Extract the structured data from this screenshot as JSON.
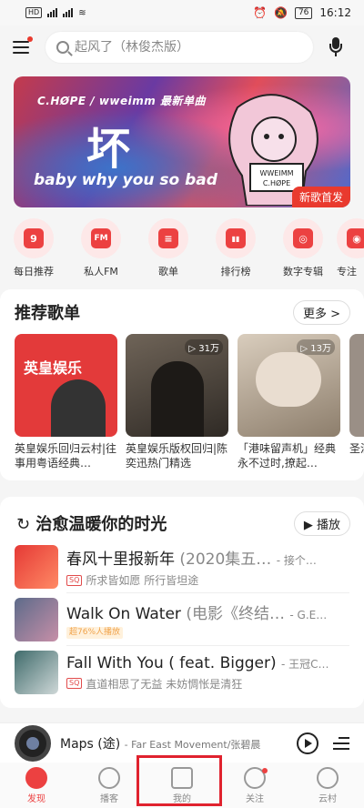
{
  "status_bar": {
    "left": "HD 2 5G 4G",
    "battery": "76",
    "time": "16:12"
  },
  "search": {
    "placeholder": "起风了（林俊杰版）"
  },
  "banner": {
    "top_text": "C.HØPE / wweimm  最新单曲",
    "big_text": "坏",
    "subtitle": "baby why you so bad",
    "badge": "新歌首发",
    "album_text": "WWEIMM C.HØPE"
  },
  "quick_entries": [
    {
      "label": "每日推荐",
      "glyph": "9",
      "icon": "calendar-icon"
    },
    {
      "label": "私人FM",
      "glyph": "FM",
      "icon": "radio-icon"
    },
    {
      "label": "歌单",
      "glyph": "≡",
      "icon": "playlist-icon"
    },
    {
      "label": "排行榜",
      "glyph": "▮▮",
      "icon": "chart-icon"
    },
    {
      "label": "数字专辑",
      "glyph": "◎",
      "icon": "album-icon"
    },
    {
      "label": "专注",
      "glyph": "◉",
      "icon": "focus-icon"
    }
  ],
  "recommended": {
    "title": "推荐歌单",
    "more": "更多 >",
    "playlists": [
      {
        "name": "英皇娱乐回归云村|往事用粤语经典…",
        "count": "",
        "cover_text": "英皇娱乐"
      },
      {
        "name": "英皇娱乐版权回归|陈奕迅热门精选",
        "count": "▷ 31万"
      },
      {
        "name": "「港味留声机」经典永不过时,撩起…",
        "count": "▷ 13万"
      },
      {
        "name": "圣洞",
        "count": ""
      }
    ]
  },
  "healing": {
    "title": "治愈温暖你的时光",
    "play": "▶ 播放",
    "songs": [
      {
        "title": "春风十里报新年",
        "subtitle": "(2020集五…",
        "artist": "- 接个…",
        "tag": "SQ",
        "desc": "所求皆如愿 所行皆坦途"
      },
      {
        "title": "Walk On Water",
        "subtitle": "(电影《终结…",
        "artist": "- G.E…",
        "tag": "超76%人播放",
        "desc": ""
      },
      {
        "title": "Fall With You ( feat. Bigger)",
        "subtitle": "",
        "artist": "- 王冠C…",
        "tag": "SQ",
        "desc": "直道相思了无益 未妨惆怅是清狂"
      }
    ]
  },
  "player": {
    "title": "Maps (途)",
    "artist": "- Far East Movement/张碧晨"
  },
  "tabs": [
    {
      "label": "发现",
      "active": true
    },
    {
      "label": "播客",
      "active": false
    },
    {
      "label": "我的",
      "active": false
    },
    {
      "label": "关注",
      "active": false,
      "dot": true
    },
    {
      "label": "云村",
      "active": false
    }
  ],
  "colors": {
    "accent": "#ec4141",
    "highlight_box": "#e0222e"
  }
}
